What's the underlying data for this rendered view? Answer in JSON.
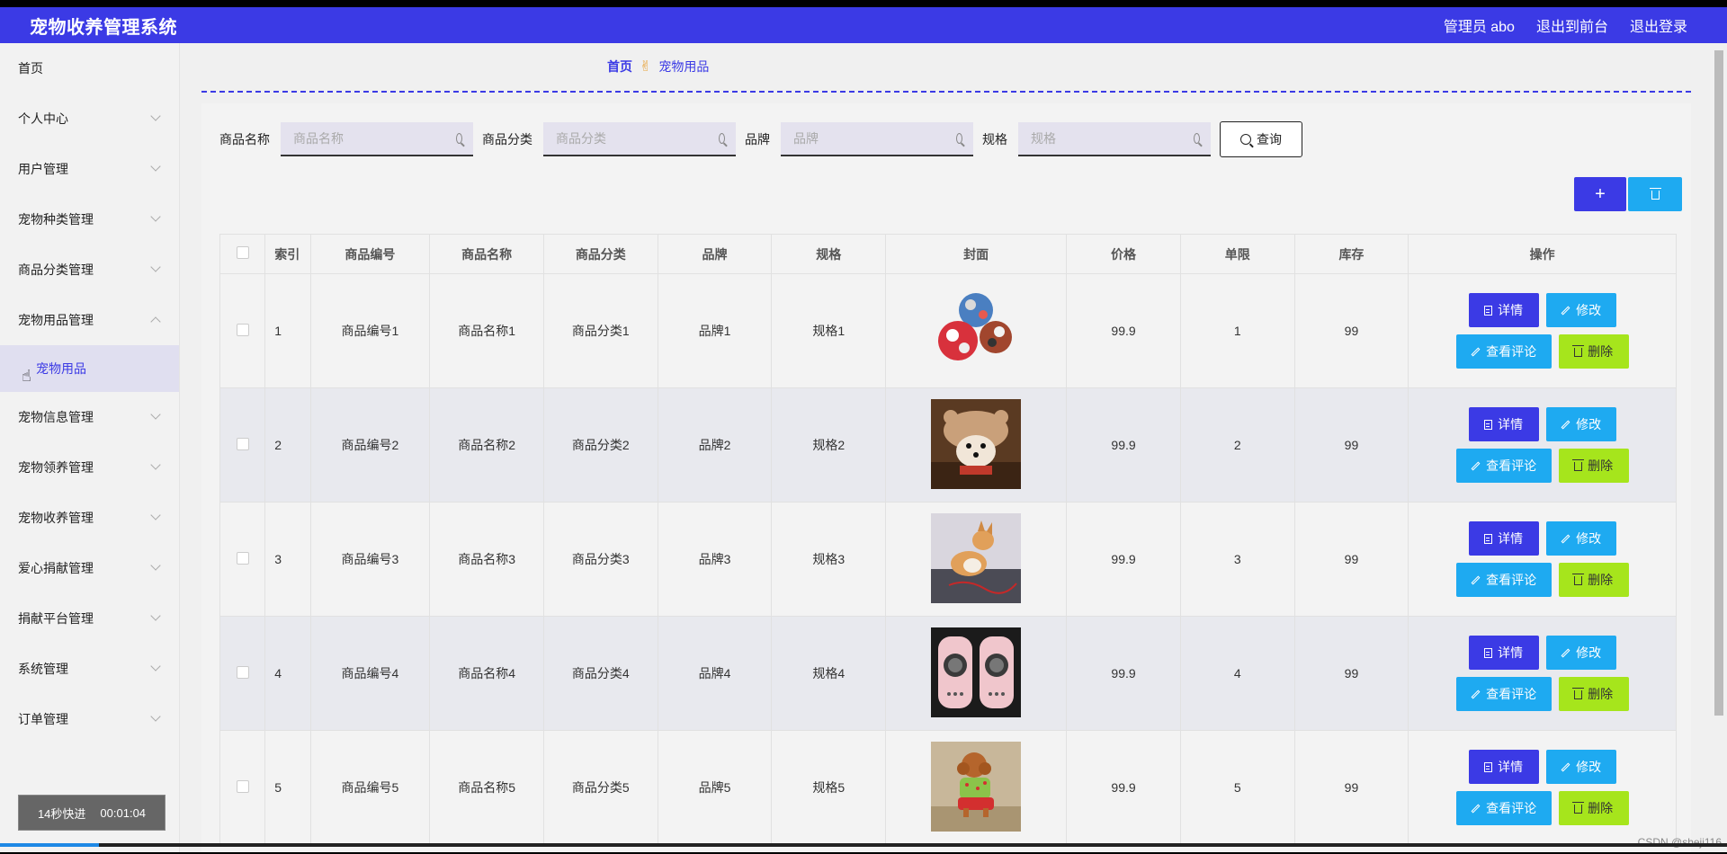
{
  "header": {
    "title": "宠物收养管理系统",
    "admin": "管理员 abo",
    "to_front": "退出到前台",
    "logout": "退出登录"
  },
  "sidebar": {
    "items": [
      {
        "label": "首页"
      },
      {
        "label": "个人中心"
      },
      {
        "label": "用户管理"
      },
      {
        "label": "宠物种类管理"
      },
      {
        "label": "商品分类管理"
      },
      {
        "label": "宠物用品管理"
      },
      {
        "label": "宠物信息管理"
      },
      {
        "label": "宠物领养管理"
      },
      {
        "label": "宠物收养管理"
      },
      {
        "label": "爱心捐献管理"
      },
      {
        "label": "捐献平台管理"
      },
      {
        "label": "系统管理"
      },
      {
        "label": "订单管理"
      }
    ],
    "active_sub": "宠物用品",
    "speed_label": "14秒快进",
    "speed_time": "00:01:04"
  },
  "breadcrumb": {
    "home": "首页",
    "current": "宠物用品"
  },
  "search": {
    "name_label": "商品名称",
    "name_placeholder": "商品名称",
    "category_label": "商品分类",
    "category_placeholder": "商品分类",
    "brand_label": "品牌",
    "brand_placeholder": "品牌",
    "spec_label": "规格",
    "spec_placeholder": "规格",
    "query": "查询"
  },
  "actions": {
    "add": "+"
  },
  "table": {
    "headers": {
      "index": "索引",
      "code": "商品编号",
      "name": "商品名称",
      "category": "商品分类",
      "brand": "品牌",
      "spec": "规格",
      "cover": "封面",
      "price": "价格",
      "limit": "单限",
      "stock": "库存",
      "ops": "操作"
    },
    "rows": [
      {
        "index": "1",
        "code": "商品编号1",
        "name": "商品名称1",
        "category": "商品分类1",
        "brand": "品牌1",
        "spec": "规格1",
        "price": "99.9",
        "limit": "1",
        "stock": "99"
      },
      {
        "index": "2",
        "code": "商品编号2",
        "name": "商品名称2",
        "category": "商品分类2",
        "brand": "品牌2",
        "spec": "规格2",
        "price": "99.9",
        "limit": "2",
        "stock": "99"
      },
      {
        "index": "3",
        "code": "商品编号3",
        "name": "商品名称3",
        "category": "商品分类3",
        "brand": "品牌3",
        "spec": "规格3",
        "price": "99.9",
        "limit": "3",
        "stock": "99"
      },
      {
        "index": "4",
        "code": "商品编号4",
        "name": "商品名称4",
        "category": "商品分类4",
        "brand": "品牌4",
        "spec": "规格4",
        "price": "99.9",
        "limit": "4",
        "stock": "99"
      },
      {
        "index": "5",
        "code": "商品编号5",
        "name": "商品名称5",
        "category": "商品分类5",
        "brand": "品牌5",
        "spec": "规格5",
        "price": "99.9",
        "limit": "5",
        "stock": "99"
      }
    ],
    "btn_detail": "详情",
    "btn_edit": "修改",
    "btn_comment": "查看评论",
    "btn_delete": "删除"
  },
  "watermark": "CSDN @sheji116"
}
